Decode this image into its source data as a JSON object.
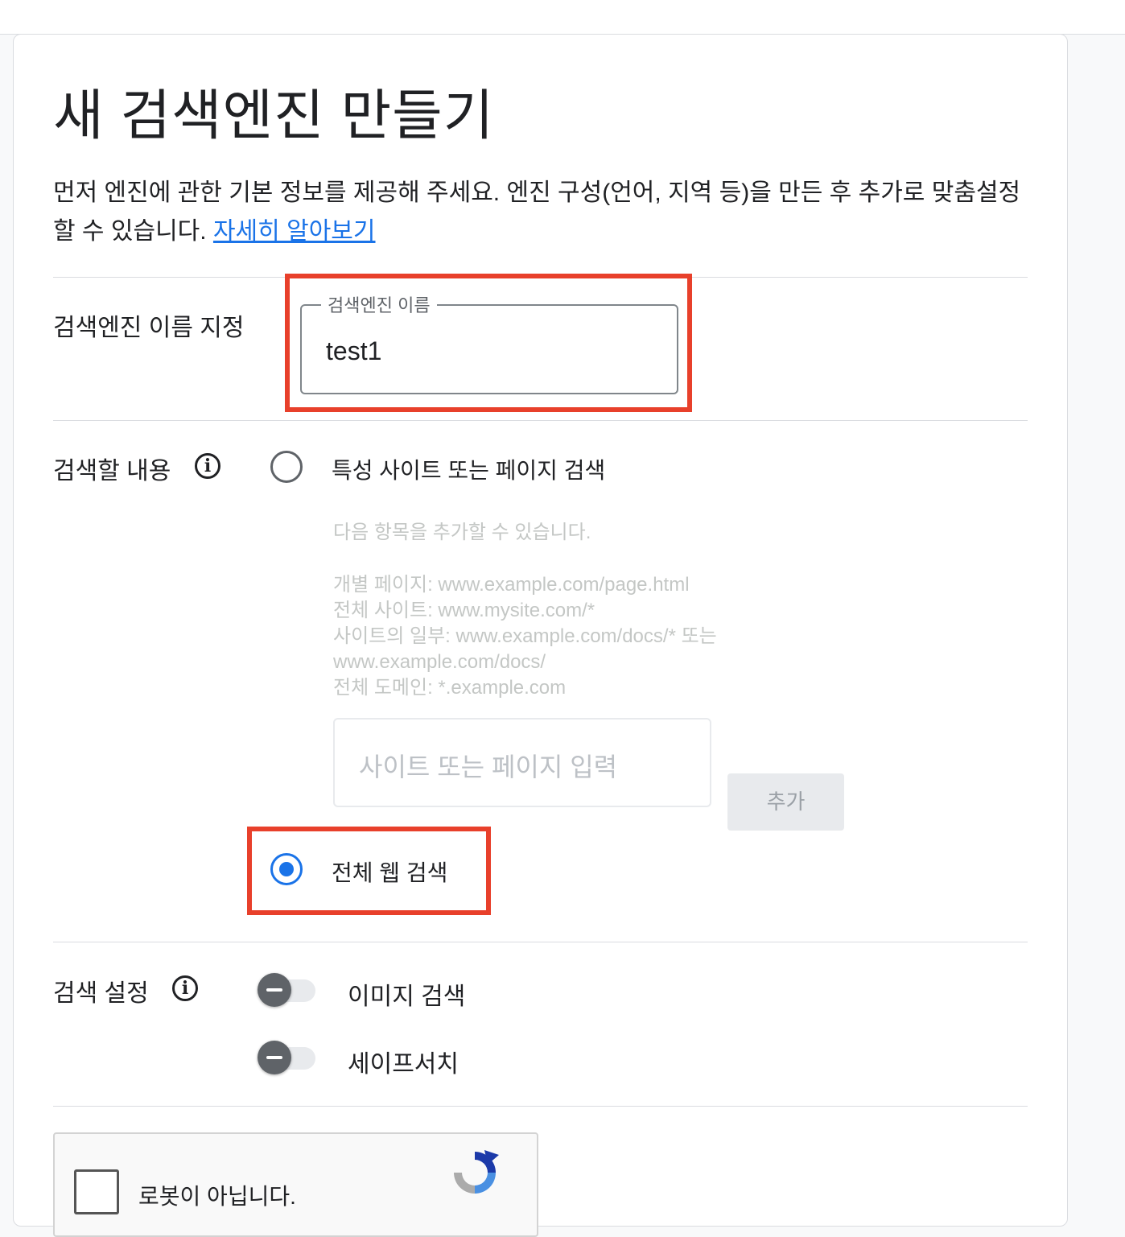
{
  "page": {
    "title": "새 검색엔진 만들기",
    "intro_text": "먼저 엔진에 관한 기본 정보를 제공해 주세요. 엔진 구성(언어, 지역 등)을 만든 후 추가로 맞춤설정할 수 있습니다. ",
    "learn_more_link": "자세히 알아보기"
  },
  "name_section": {
    "label": "검색엔진 이름 지정",
    "field_legend": "검색엔진 이름",
    "field_value": "test1"
  },
  "content_section": {
    "label": "검색할 내용",
    "options": [
      {
        "label": "특성 사이트 또는 페이지 검색",
        "selected": false
      },
      {
        "label": "전체 웹 검색",
        "selected": true
      }
    ],
    "hint_intro": "다음 항목을 추가할 수 있습니다.",
    "hint_lines": [
      "개별 페이지: www.example.com/page.html",
      "전체 사이트: www.mysite.com/*",
      "사이트의 일부: www.example.com/docs/* 또는",
      "www.example.com/docs/",
      "전체 도메인: *.example.com"
    ],
    "site_input_placeholder": "사이트 또는 페이지 입력",
    "add_button": "추가"
  },
  "settings_section": {
    "label": "검색 설정",
    "toggles": [
      {
        "label": "이미지 검색",
        "on": false
      },
      {
        "label": "세이프서치",
        "on": false
      }
    ]
  },
  "captcha": {
    "label": "로봇이 아닙니다."
  },
  "colors": {
    "accent": "#1a73e8",
    "highlight_border": "#e8402b",
    "divider": "#dadce0"
  }
}
